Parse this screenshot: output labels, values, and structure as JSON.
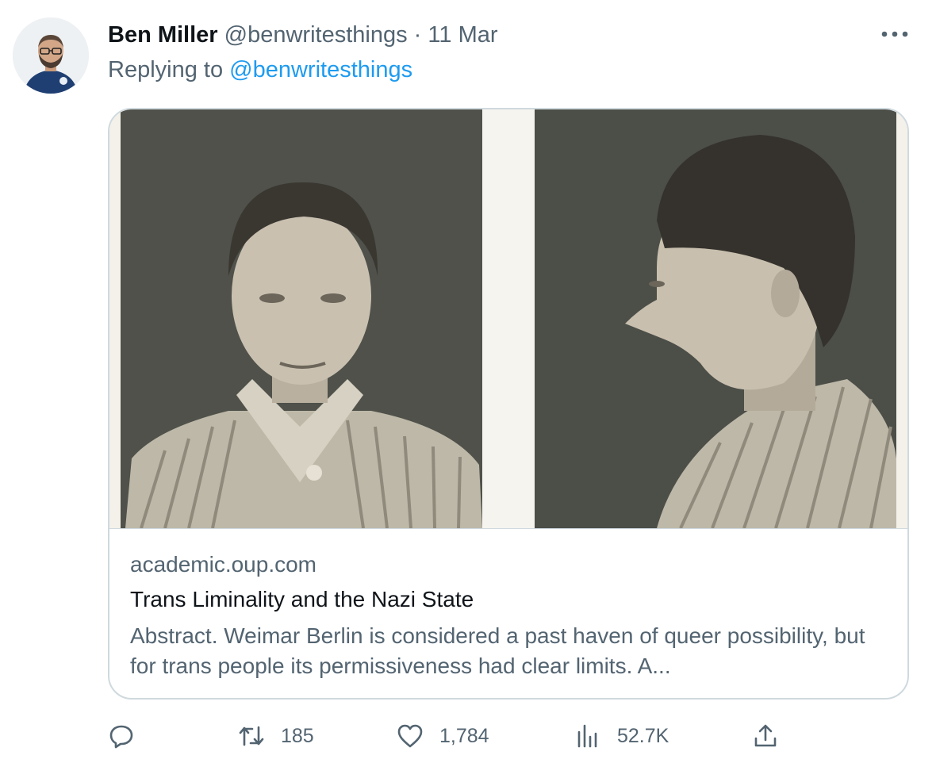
{
  "tweet": {
    "author_name": "Ben Miller",
    "handle": "@benwritesthings",
    "separator": "·",
    "date": "11 Mar",
    "replying_prefix": "Replying to",
    "replying_to": "@benwritesthings"
  },
  "card": {
    "domain": "academic.oup.com",
    "title": "Trans Liminality and the Nazi State",
    "description": "Abstract. Weimar Berlin is considered a past haven of queer possibility, but for trans people its permissiveness had clear limits. A..."
  },
  "actions": {
    "reply_icon": "reply-icon",
    "retweet_count": "185",
    "like_count": "1,784",
    "views_count": "52.7K",
    "share_icon": "share-icon"
  },
  "colors": {
    "link": "#1d9bf0",
    "secondary_text": "#536471",
    "border": "#cfd9de"
  }
}
